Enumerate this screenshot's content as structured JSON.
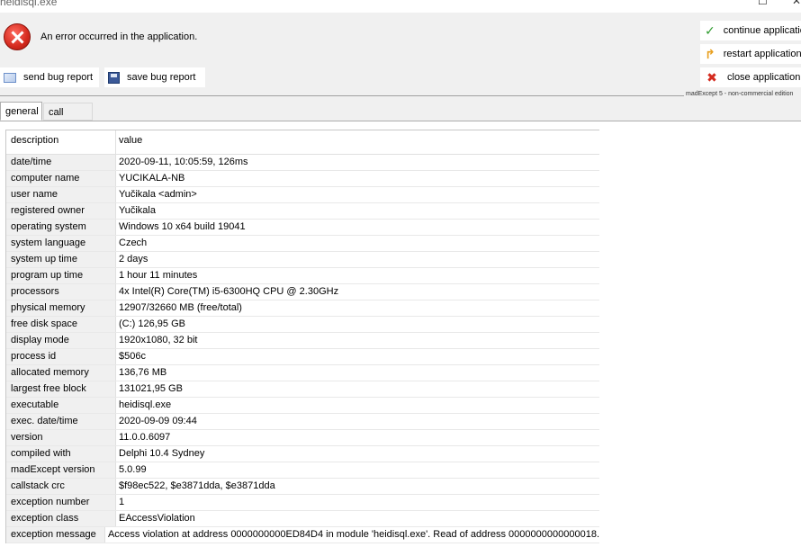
{
  "window": {
    "title": "heidisql.exe"
  },
  "error": {
    "message": "An error occurred in the application."
  },
  "bug_buttons": {
    "send": "send bug report",
    "save": "save bug report"
  },
  "side_buttons": {
    "continue": "continue application",
    "restart": "restart application",
    "close": "close application"
  },
  "separator": {
    "label": "madExcept 5 - non-commercial edition"
  },
  "tabs": {
    "general": "general",
    "call_stack": "call stack"
  },
  "table": {
    "header": {
      "key": "description",
      "value": "value"
    },
    "rows": [
      {
        "key": "date/time",
        "value": "2020-09-11, 10:05:59, 126ms"
      },
      {
        "key": "computer name",
        "value": "YUCIKALA-NB"
      },
      {
        "key": "user name",
        "value": "Yučikala  <admin>"
      },
      {
        "key": "registered owner",
        "value": "Yučikala"
      },
      {
        "key": "operating system",
        "value": "Windows 10 x64 build 19041"
      },
      {
        "key": "system language",
        "value": "Czech"
      },
      {
        "key": "system up time",
        "value": "2 days"
      },
      {
        "key": "program up time",
        "value": "1 hour 11 minutes"
      },
      {
        "key": "processors",
        "value": "4x Intel(R) Core(TM) i5-6300HQ CPU @ 2.30GHz"
      },
      {
        "key": "physical memory",
        "value": "12907/32660 MB (free/total)"
      },
      {
        "key": "free disk space",
        "value": "(C:) 126,95 GB"
      },
      {
        "key": "display mode",
        "value": "1920x1080, 32 bit"
      },
      {
        "key": "process id",
        "value": "$506c"
      },
      {
        "key": "allocated memory",
        "value": "136,76 MB"
      },
      {
        "key": "largest free block",
        "value": "131021,95 GB"
      },
      {
        "key": "executable",
        "value": "heidisql.exe"
      },
      {
        "key": "exec. date/time",
        "value": "2020-09-09 09:44"
      },
      {
        "key": "version",
        "value": "11.0.0.6097"
      },
      {
        "key": "compiled with",
        "value": "Delphi 10.4 Sydney"
      },
      {
        "key": "madExcept version",
        "value": "5.0.99"
      },
      {
        "key": "callstack crc",
        "value": "$f98ec522, $e3871dda, $e3871dda"
      },
      {
        "key": "exception number",
        "value": "1"
      },
      {
        "key": "exception class",
        "value": "EAccessViolation"
      },
      {
        "key": "exception message",
        "value": "Access violation at address 0000000000ED84D4 in module 'heidisql.exe'. Read of address 0000000000000018."
      }
    ]
  },
  "colors": {
    "error_red": "#d42a1e",
    "check_green": "#2e9b2e",
    "restart_orange": "#e8a020"
  },
  "icons": {
    "error": "error-x-icon",
    "send": "envelope-icon",
    "save": "floppy-disk-icon",
    "continue": "checkmark-icon",
    "restart": "restart-arrow-icon",
    "close": "close-x-icon"
  }
}
